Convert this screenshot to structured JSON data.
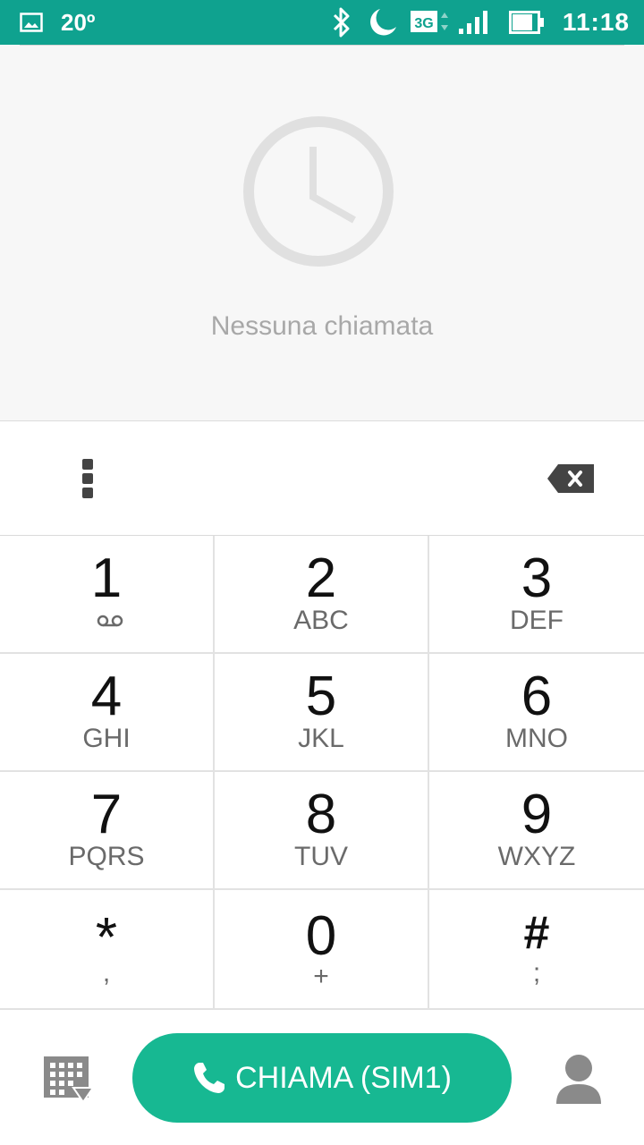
{
  "status_bar": {
    "temperature": "20º",
    "network_type": "3G",
    "time": "11:18",
    "icons": [
      "gallery-icon",
      "bluetooth-icon",
      "moon-icon",
      "3g-icon",
      "signal-icon",
      "battery-icon"
    ],
    "background": "#0fa28f"
  },
  "recents": {
    "empty_icon": "clock-icon",
    "empty_text": "Nessuna chiamata"
  },
  "digits_bar": {
    "menu_icon": "overflow-menu-icon",
    "delete_icon": "backspace-icon"
  },
  "keypad": {
    "keys": [
      {
        "digit": "1",
        "letters": ""
      },
      {
        "digit": "2",
        "letters": "ABC"
      },
      {
        "digit": "3",
        "letters": "DEF"
      },
      {
        "digit": "4",
        "letters": "GHI"
      },
      {
        "digit": "5",
        "letters": "JKL"
      },
      {
        "digit": "6",
        "letters": "MNO"
      },
      {
        "digit": "7",
        "letters": "PQRS"
      },
      {
        "digit": "8",
        "letters": "TUV"
      },
      {
        "digit": "9",
        "letters": "WXYZ"
      },
      {
        "digit": "*",
        "letters": ","
      },
      {
        "digit": "0",
        "letters": "+"
      },
      {
        "digit": "#",
        "letters": ";"
      }
    ]
  },
  "bottom_bar": {
    "call_label": "CHIAMA (SIM1)",
    "call_color": "#17b892",
    "left_icon": "dialpad-icon",
    "right_icon": "contact-icon"
  }
}
